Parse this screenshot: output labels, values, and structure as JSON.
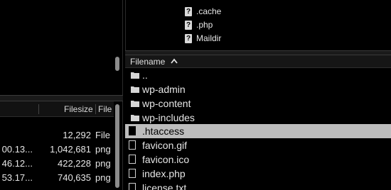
{
  "remote_tree": {
    "items": [
      {
        "icon": "unknown-icon",
        "name": ".cache"
      },
      {
        "icon": "unknown-icon",
        "name": ".php"
      },
      {
        "icon": "unknown-icon",
        "name": "Maildir"
      }
    ]
  },
  "remote_list": {
    "header": {
      "filename_label": "Filename",
      "sort": "ascending"
    },
    "rows": [
      {
        "icon": "folder-icon",
        "name": "..",
        "selected": false
      },
      {
        "icon": "folder-icon",
        "name": "wp-admin",
        "selected": false
      },
      {
        "icon": "folder-icon",
        "name": "wp-content",
        "selected": false
      },
      {
        "icon": "folder-icon",
        "name": "wp-includes",
        "selected": false
      },
      {
        "icon": "file-icon",
        "name": ".htaccess",
        "selected": true
      },
      {
        "icon": "file-icon",
        "name": "favicon.gif",
        "selected": false
      },
      {
        "icon": "file-icon",
        "name": "favicon.ico",
        "selected": false
      },
      {
        "icon": "file-icon",
        "name": "index.php",
        "selected": false
      },
      {
        "icon": "file-icon",
        "name": "license.txt",
        "selected": false
      }
    ]
  },
  "local_list": {
    "header": {
      "filesize_label": "Filesize",
      "type_label": "File"
    },
    "rows": [
      {
        "modified": "",
        "size": "12,292",
        "type": "File"
      },
      {
        "modified": "00.13...",
        "size": "1,042,681",
        "type": "png"
      },
      {
        "modified": "46.12...",
        "size": "422,228",
        "type": "png"
      },
      {
        "modified": "53.17...",
        "size": "740,635",
        "type": "png"
      }
    ]
  },
  "colors": {
    "background": "#000000",
    "selection": "#bdbdbd",
    "scroll_thumb": "#8c8c8c"
  }
}
